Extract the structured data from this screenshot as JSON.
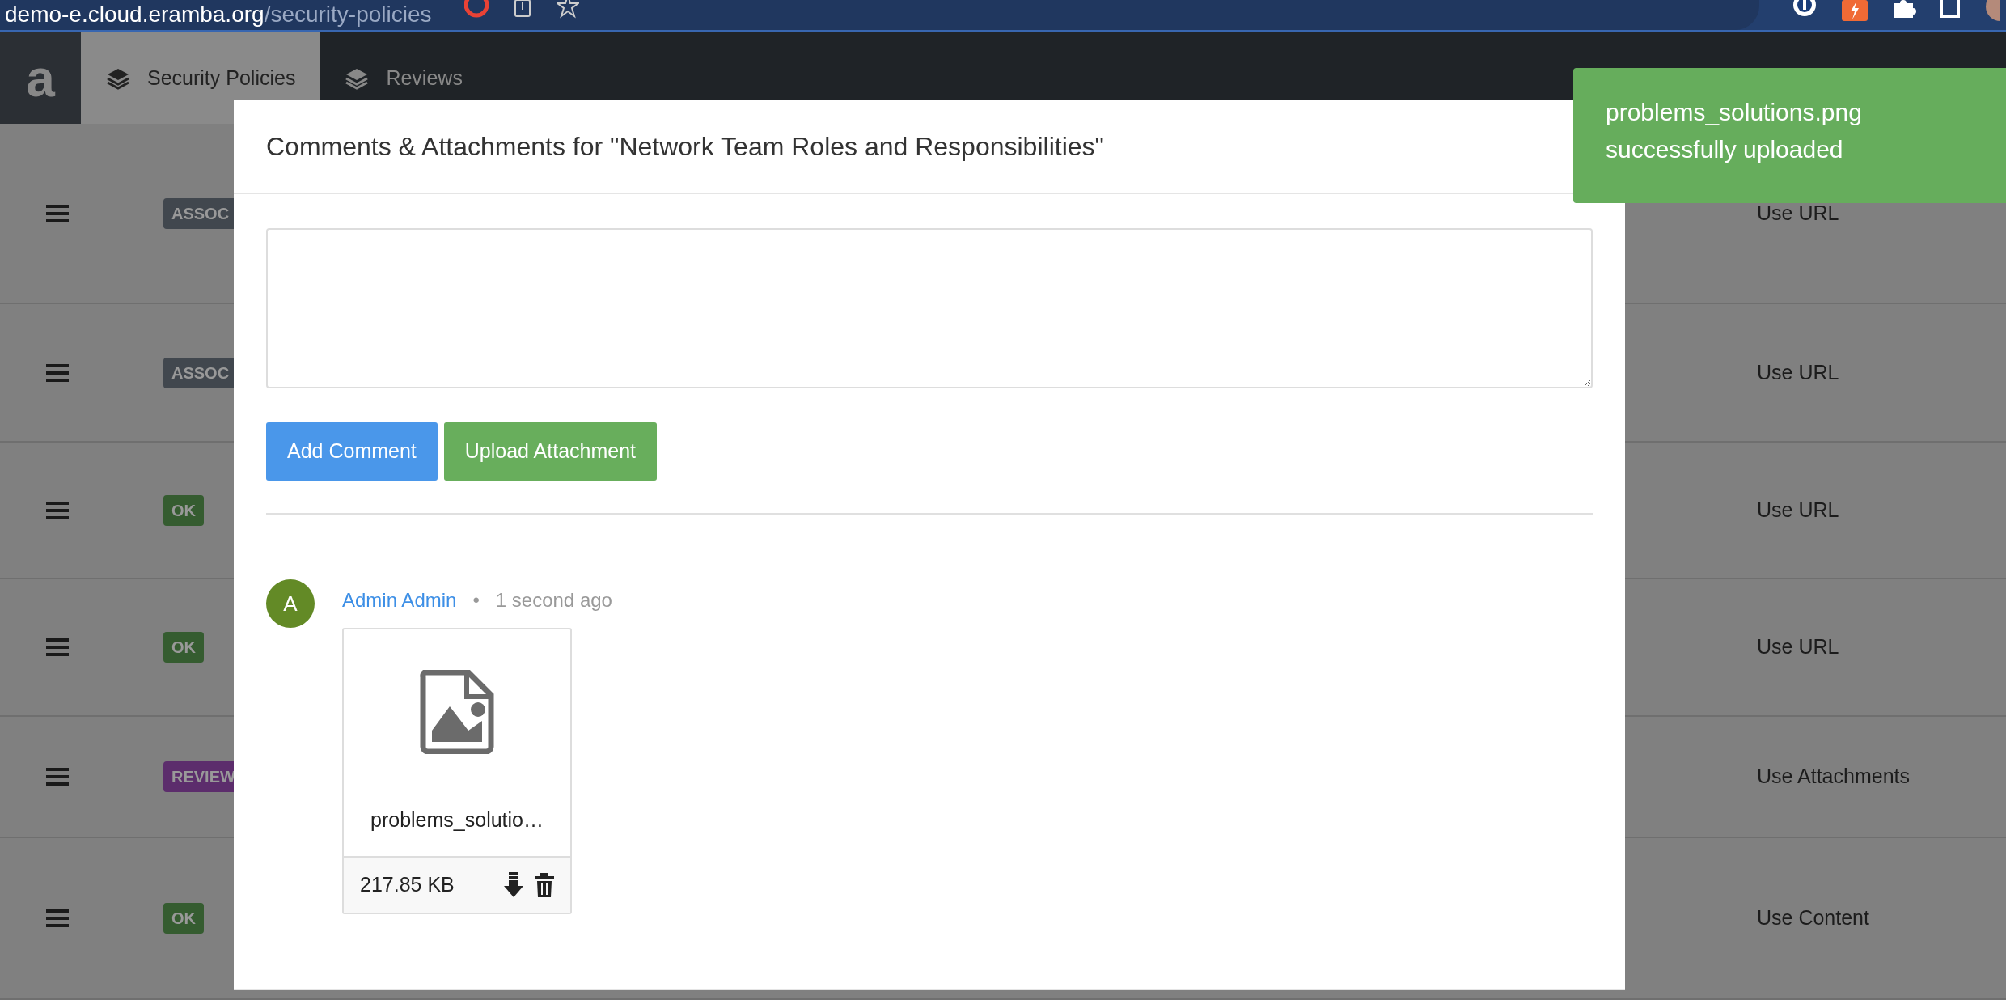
{
  "browser": {
    "url_host": "demo-e.cloud.eramba.org",
    "url_path": "/security-policies"
  },
  "navbar": {
    "logo": "a",
    "tabs": [
      {
        "label": "Security Policies",
        "selected": true
      },
      {
        "label": "Reviews",
        "selected": false
      }
    ]
  },
  "table": {
    "rows": [
      {
        "status": "ASSOC",
        "color": "#41474e",
        "source": "Use URL"
      },
      {
        "status": "ASSOC",
        "color": "#41474e",
        "source": "Use URL"
      },
      {
        "status": "OK",
        "color": "#355c30",
        "source": "Use URL"
      },
      {
        "status": "OK",
        "color": "#355c30",
        "source": "Use URL"
      },
      {
        "status": "REVIEW",
        "color": "#5c2d6c",
        "source": "Use Attachments"
      },
      {
        "status": "OK",
        "color": "#355c30",
        "source": "Use Content"
      }
    ]
  },
  "modal": {
    "title": "Comments & Attachments for \"Network Team Roles and Responsibilities\"",
    "buttons": [
      {
        "label": "Add Comment",
        "kind": "primary"
      },
      {
        "label": "Upload Attachment",
        "kind": "success"
      }
    ],
    "comments": [
      {
        "avatar": "A",
        "author": "Admin Admin",
        "separator": "•",
        "time": "1 second ago",
        "attachments": [
          {
            "filename": "problems_solutio…",
            "size": "217.85 KB"
          }
        ]
      }
    ]
  },
  "toast": {
    "message": "problems_solutions.png successfully uploaded"
  }
}
